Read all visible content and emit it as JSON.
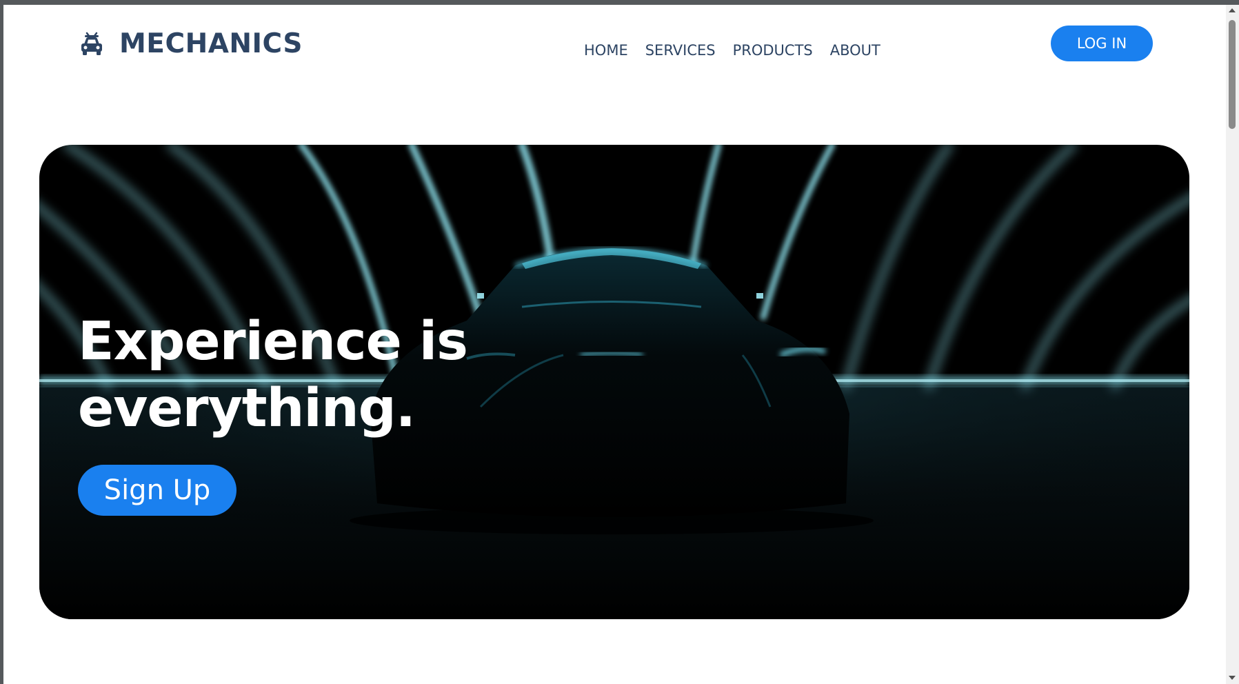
{
  "header": {
    "brand_name": "MECHANICS",
    "brand_icon": "car-icon",
    "nav": {
      "home": "HOME",
      "services": "SERVICES",
      "products": "PRODUCTS",
      "about": "ABOUT"
    },
    "login_label": "LOG IN"
  },
  "hero": {
    "title_line1": "Experience is",
    "title_line2": "everything.",
    "signup_label": "Sign Up",
    "background_image": "dark-sports-car-neon-tunnel"
  },
  "colors": {
    "accent": "#1a80ef",
    "brand_text": "#2d4463",
    "neon": "#8fe3ee",
    "hero_bg": "#000000"
  }
}
